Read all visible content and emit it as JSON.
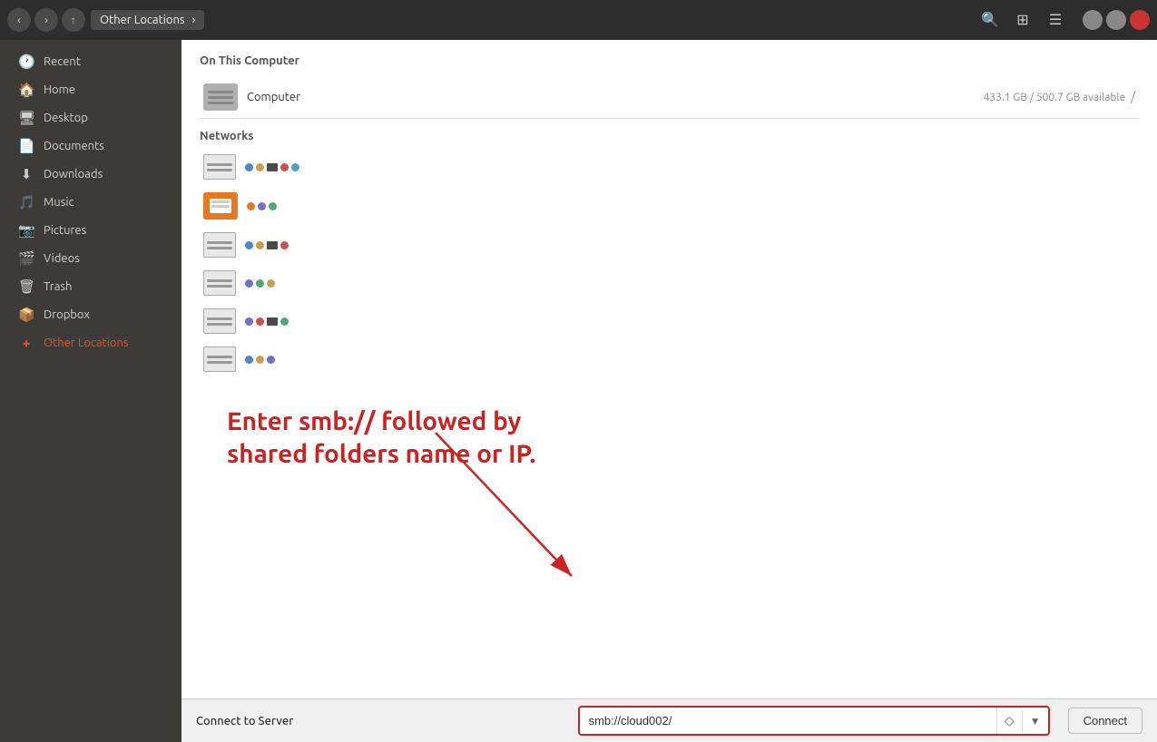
{
  "titlebar": {
    "location": "Other Locations",
    "back_label": "‹",
    "forward_label": "›",
    "up_label": "↑",
    "chevron_label": "›",
    "search_label": "🔍",
    "view_label": "⊞",
    "menu_label": "☰"
  },
  "window_controls": {
    "minimize_label": "—",
    "maximize_label": "□",
    "close_label": "✕"
  },
  "sidebar": {
    "items": [
      {
        "id": "recent",
        "label": "Recent",
        "icon": "🕐"
      },
      {
        "id": "home",
        "label": "Home",
        "icon": "🏠"
      },
      {
        "id": "desktop",
        "label": "Desktop",
        "icon": "🖥"
      },
      {
        "id": "documents",
        "label": "Documents",
        "icon": "📄"
      },
      {
        "id": "downloads",
        "label": "Downloads",
        "icon": "⬇"
      },
      {
        "id": "music",
        "label": "Music",
        "icon": "🎵"
      },
      {
        "id": "pictures",
        "label": "Pictures",
        "icon": "📷"
      },
      {
        "id": "videos",
        "label": "Videos",
        "icon": "🎬"
      },
      {
        "id": "trash",
        "label": "Trash",
        "icon": "🗑"
      },
      {
        "id": "dropbox",
        "label": "Dropbox",
        "icon": "📦"
      },
      {
        "id": "other-locations",
        "label": "Other Locations",
        "icon": "+"
      }
    ]
  },
  "content": {
    "on_this_computer_label": "On This Computer",
    "computer_label": "Computer",
    "computer_space": "433.1 GB / 500.7 GB available",
    "computer_slash": "/",
    "networks_label": "Networks",
    "network_items": [
      {
        "id": "net1",
        "colors": [
          "#4a86c8",
          "#c8a050",
          "#c85050",
          "#50a0c8"
        ]
      },
      {
        "id": "net2",
        "colors": [
          "#e87820",
          "#7070c8",
          "#50a878"
        ]
      },
      {
        "id": "net3",
        "colors": [
          "#4a86c8",
          "#c8a050",
          "#c85050"
        ]
      },
      {
        "id": "net4",
        "colors": [
          "#7070c8",
          "#50a878",
          "#c8a050",
          "#c85050"
        ]
      },
      {
        "id": "net5",
        "colors": [
          "#7070c8",
          "#c85050",
          "#50a878"
        ]
      },
      {
        "id": "net6",
        "colors": [
          "#4a86c8",
          "#c8a050",
          "#7070c8"
        ]
      }
    ]
  },
  "annotation": {
    "text": "Enter smb:// followed by shared folders name or IP."
  },
  "bottom_bar": {
    "connect_to_server_label": "Connect to Server",
    "input_value": "smb://cloud002/",
    "connect_button_label": "Connect"
  }
}
